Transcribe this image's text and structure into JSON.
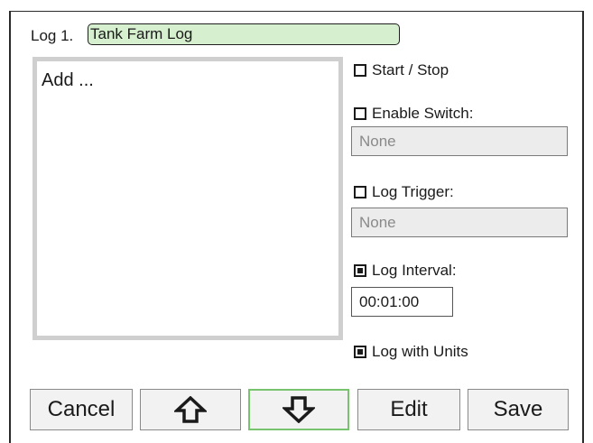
{
  "header": {
    "log_label": "Log 1.",
    "log_name": "Tank Farm Log"
  },
  "list": {
    "items": [
      "Add ..."
    ]
  },
  "options": {
    "start_stop": {
      "label": "Start / Stop",
      "checked": false
    },
    "enable_switch": {
      "label": "Enable Switch:",
      "checked": false,
      "value": "None"
    },
    "log_trigger": {
      "label": "Log Trigger:",
      "checked": false,
      "value": "None"
    },
    "log_interval": {
      "label": "Log Interval:",
      "checked": true,
      "value": "00:01:00"
    },
    "log_with_units": {
      "label": "Log with Units",
      "checked": true
    }
  },
  "buttons": {
    "cancel": "Cancel",
    "up_icon": "up-arrow-icon",
    "down_icon": "down-arrow-icon",
    "edit": "Edit",
    "save": "Save"
  },
  "colors": {
    "name_field_bg": "#d6efcf",
    "active_button_border": "#78c36e",
    "list_border": "#cfcfcf",
    "disabled_field_bg": "#ececec"
  }
}
